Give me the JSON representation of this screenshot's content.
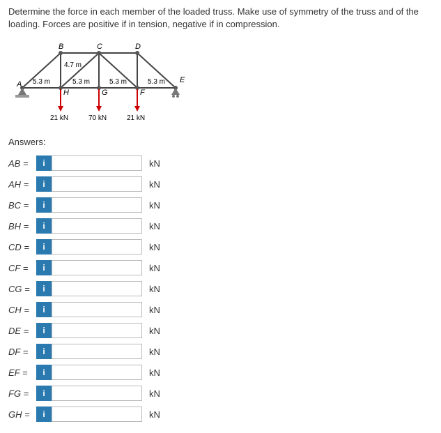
{
  "question": "Determine the force in each member of the loaded truss. Make use of symmetry of the truss and of the loading. Forces are positive if in tension, negative if in compression.",
  "diagram": {
    "nodes": {
      "A": "A",
      "B": "B",
      "C": "C",
      "D": "D",
      "E": "E",
      "F": "F",
      "G": "G",
      "H": "H"
    },
    "dims": {
      "height": "4.7 m",
      "span1": "5.3 m",
      "span2": "5.3 m",
      "span3": "5.3 m",
      "span4": "5.3 m"
    },
    "loads": {
      "h": "21 kN",
      "g": "70 kN",
      "f": "21 kN"
    }
  },
  "answers_label": "Answers:",
  "info_badge": "i",
  "unit": "kN",
  "members": [
    {
      "label": "AB ="
    },
    {
      "label": "AH ="
    },
    {
      "label": "BC ="
    },
    {
      "label": "BH ="
    },
    {
      "label": "CD ="
    },
    {
      "label": "CF ="
    },
    {
      "label": "CG ="
    },
    {
      "label": "CH ="
    },
    {
      "label": "DE ="
    },
    {
      "label": "DF ="
    },
    {
      "label": "EF ="
    },
    {
      "label": "FG ="
    },
    {
      "label": "GH ="
    }
  ]
}
